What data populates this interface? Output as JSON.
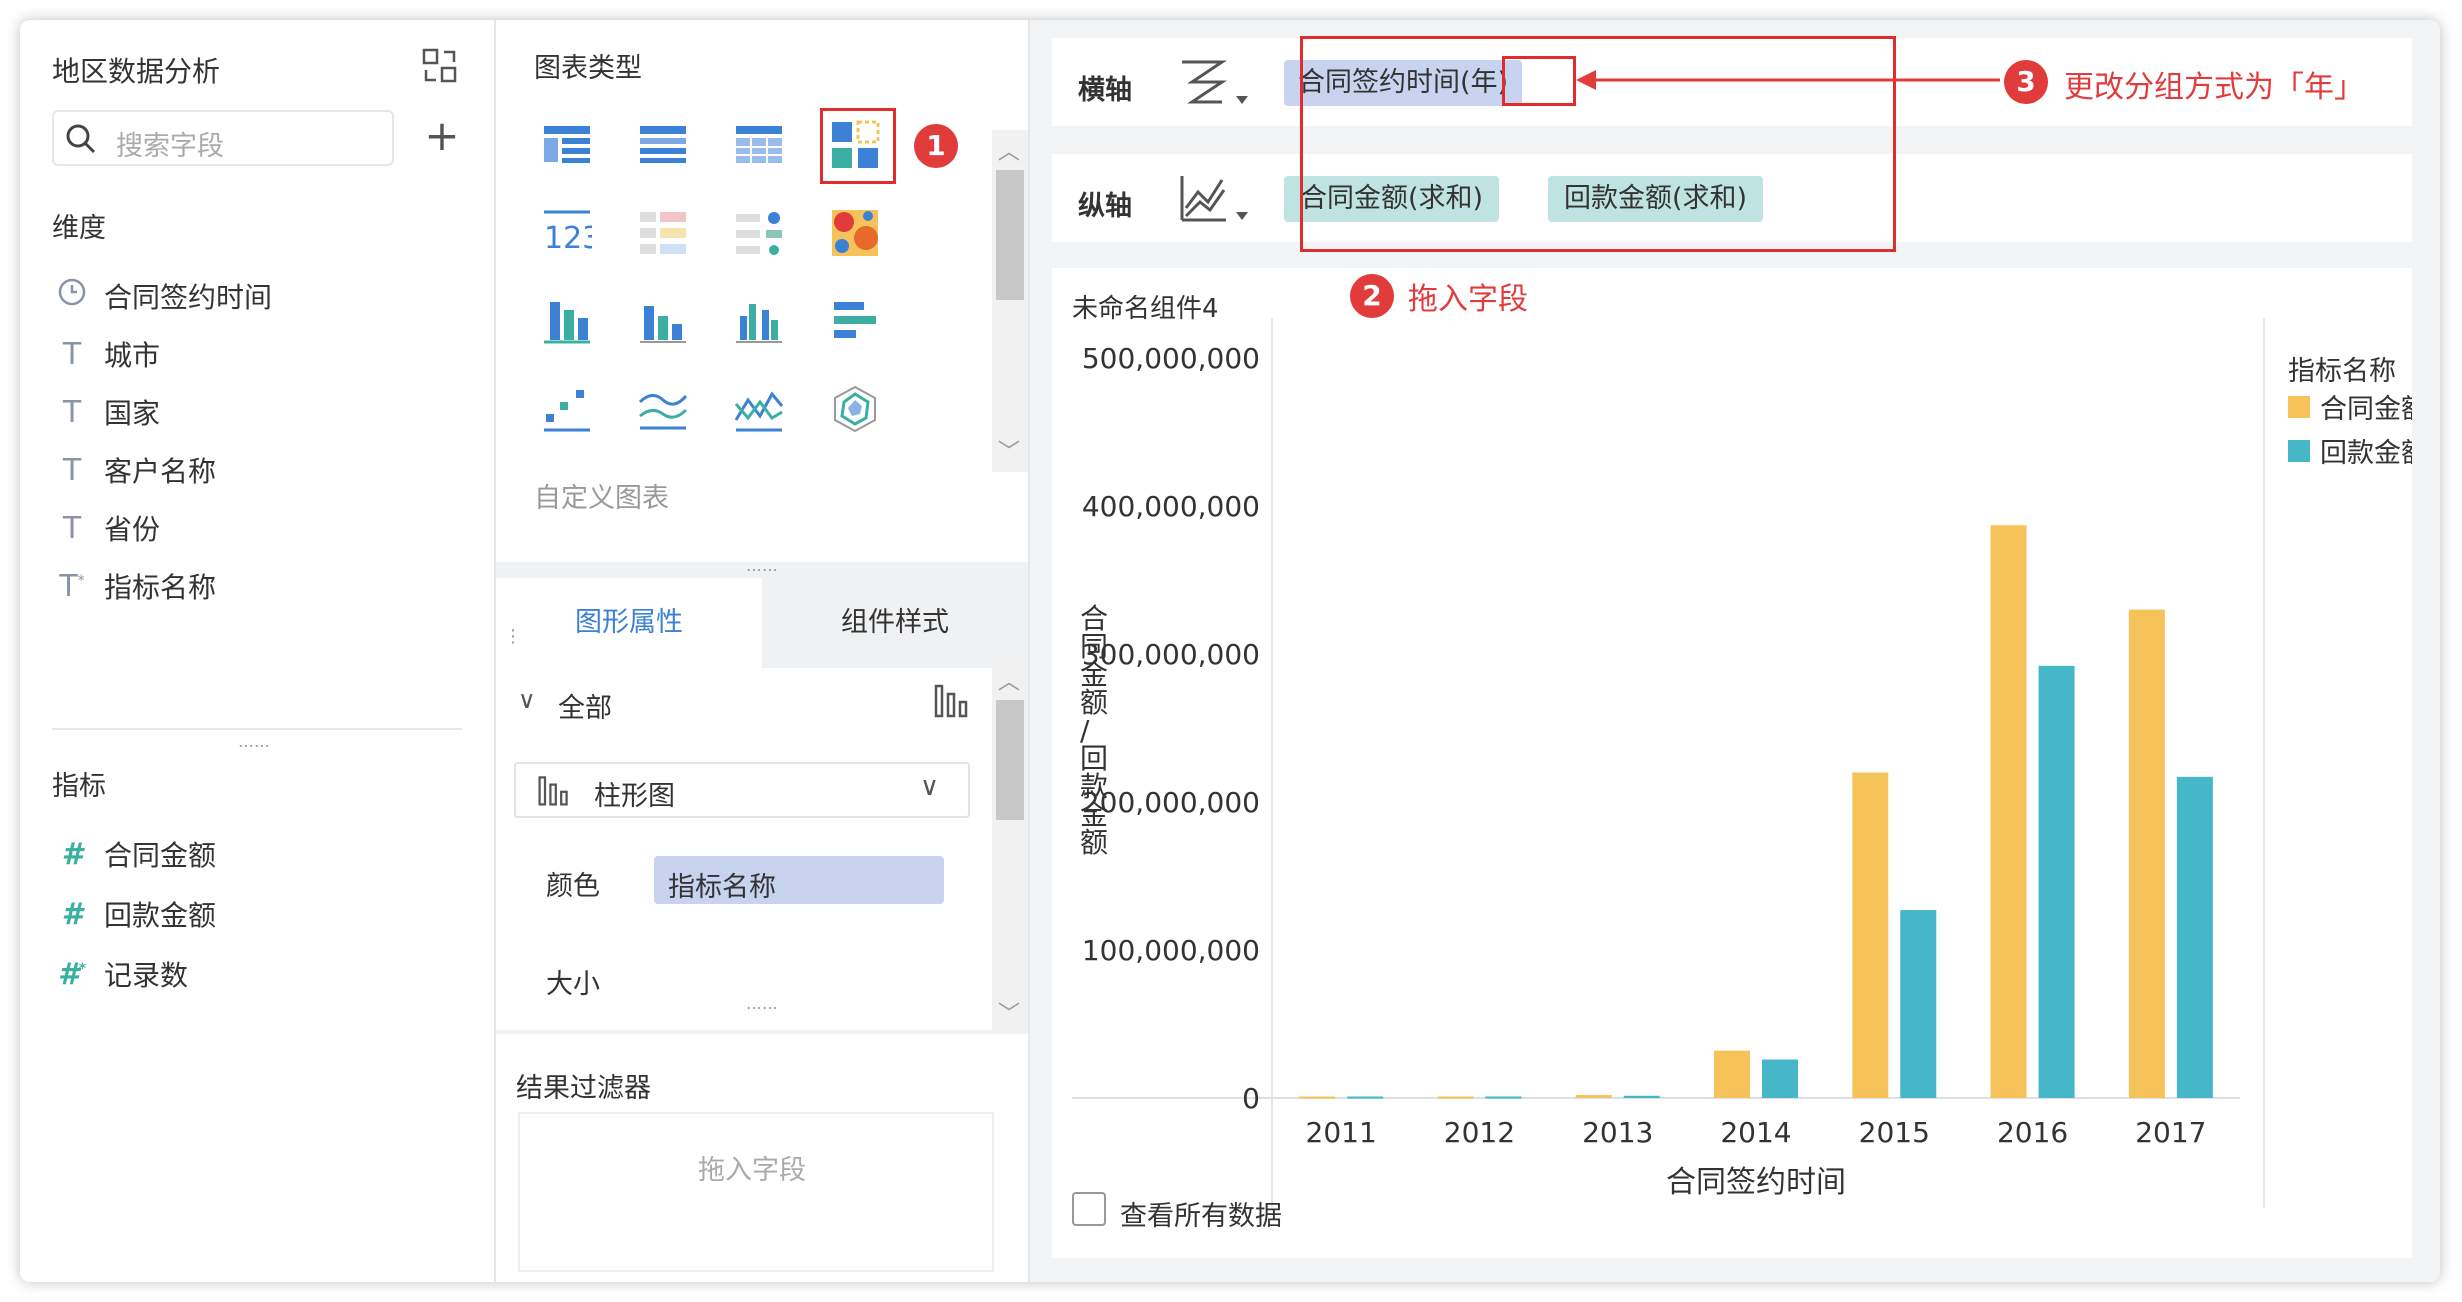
{
  "left_panel": {
    "title": "地区数据分析",
    "search_placeholder": "搜索字段",
    "dimensions_label": "维度",
    "dimensions": [
      {
        "label": "合同签约时间",
        "icon": "clock-icon"
      },
      {
        "label": "城市",
        "icon": "text-type-icon"
      },
      {
        "label": "国家",
        "icon": "text-type-icon"
      },
      {
        "label": "客户名称",
        "icon": "text-type-icon"
      },
      {
        "label": "省份",
        "icon": "text-type-icon"
      },
      {
        "label": "指标名称",
        "icon": "text-type-icon"
      }
    ],
    "metrics_label": "指标",
    "metrics": [
      {
        "label": "合同金额",
        "icon": "hash-icon"
      },
      {
        "label": "回款金额",
        "icon": "hash-icon"
      },
      {
        "label": "记录数",
        "icon": "hash-icon"
      }
    ]
  },
  "middle_panel": {
    "chart_type_title": "图表类型",
    "custom_chart_label": "自定义图表",
    "tabs": [
      "图形属性",
      "组件样式"
    ],
    "all_label": "全部",
    "chart_type_select": "柱形图",
    "color_label": "颜色",
    "color_field": "指标名称",
    "size_label": "大小",
    "filter_title": "结果过滤器",
    "filter_placeholder": "拖入字段"
  },
  "right_panel": {
    "x_axis_label": "横轴",
    "y_axis_label": "纵轴",
    "x_axis_field": "合同签约时间",
    "x_axis_group": "(年)",
    "y_axis_fields": [
      "合同金额(求和)",
      "回款金额(求和)"
    ],
    "component_title": "未命名组件4",
    "view_all_label": "查看所有数据"
  },
  "annotations": {
    "step1": "1",
    "step2": "2",
    "step3": "3",
    "step2_text": "拖入字段",
    "step3_text": "更改分组方式为「年」"
  },
  "chart_data": {
    "type": "bar",
    "categories": [
      "2011",
      "2012",
      "2013",
      "2014",
      "2015",
      "2016",
      "2017"
    ],
    "series": [
      {
        "name": "合同金额",
        "values": [
          1000000,
          1000000,
          2000000,
          32000000,
          220000000,
          387000000,
          330000000
        ]
      },
      {
        "name": "回款金额",
        "values": [
          1000000,
          1000000,
          1500000,
          26000000,
          127000000,
          292000000,
          217000000
        ]
      }
    ],
    "xlabel": "合同签约时间",
    "ylabel": "合同金额/回款金额",
    "legend_title": "指标名称",
    "yticks": [
      "0",
      "100,000,000",
      "200,000,000",
      "300,000,000",
      "400,000,000",
      "500,000,000"
    ],
    "ylim": [
      0,
      500000000
    ],
    "colors": [
      "#f6c35a",
      "#45b7c8"
    ],
    "legend_position": "right",
    "grid": false
  }
}
